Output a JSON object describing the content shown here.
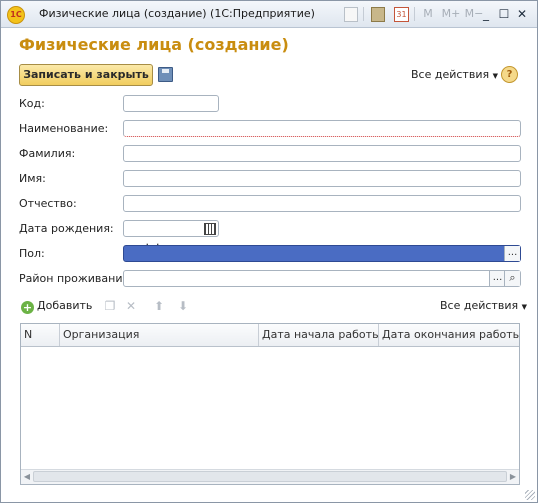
{
  "window": {
    "title": "Физические лица (создание)  (1С:Предприятие)",
    "app_icon": "1С",
    "title_icons": [
      "document-icon",
      "calculator-icon",
      "calendar-icon"
    ],
    "calendar_day": "31",
    "memory_buttons": [
      "M",
      "M+",
      "M−"
    ]
  },
  "form": {
    "title": "Физические лица (создание)",
    "save_close_label": "Записать и закрыть",
    "all_actions_label": "Все действия",
    "help_label": "?"
  },
  "fields": {
    "code": {
      "label": "Код:",
      "value": ""
    },
    "name": {
      "label": "Наименование:",
      "value": ""
    },
    "surname": {
      "label": "Фамилия:",
      "value": ""
    },
    "first_name": {
      "label": "Имя:",
      "value": ""
    },
    "patronymic": {
      "label": "Отчество:",
      "value": ""
    },
    "birth_date": {
      "label": "Дата рождения:",
      "value": " .  ."
    },
    "gender": {
      "label": "Пол:",
      "value": "",
      "select_btn": "..."
    },
    "district": {
      "label": "Район проживания:",
      "value": "",
      "select_btn": "...",
      "search_icon": "search-icon"
    }
  },
  "table": {
    "add_label": "Добавить",
    "all_actions_label": "Все действия",
    "columns": [
      "N",
      "Организация",
      "Дата начала работы",
      "Дата окончания работы"
    ],
    "rows": []
  },
  "colors": {
    "title_accent": "#c98d10",
    "selection": "#4a6cc3",
    "save_button": "#f1cd5e"
  }
}
